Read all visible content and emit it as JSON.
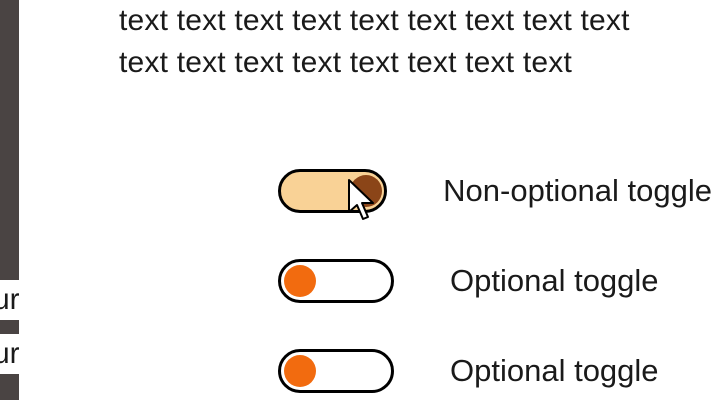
{
  "left_fragments": [
    "ur",
    "ur"
  ],
  "paragraph": {
    "lines": [
      "text text text text text text text text text",
      "text text text text text text text text"
    ]
  },
  "toggles": [
    {
      "label": "Non-optional toggle",
      "state": "on"
    },
    {
      "label": "Optional toggle",
      "state": "off"
    },
    {
      "label": "Optional toggle",
      "state": "off"
    }
  ],
  "colors": {
    "toggle_on_track": "#f9d296",
    "toggle_on_knob": "#8b4518",
    "toggle_off_knob": "#f26b0f",
    "side_panel": "#4a4443"
  }
}
